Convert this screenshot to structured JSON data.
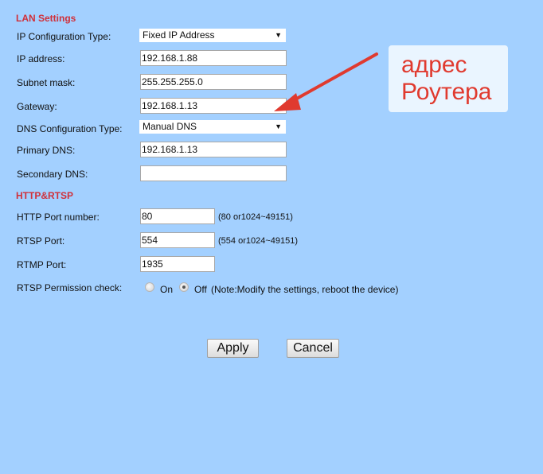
{
  "lan": {
    "title": "LAN Settings",
    "ip_config_label": "IP Configuration Type:",
    "ip_config_value": "Fixed IP Address",
    "ip_address_label": "IP address:",
    "ip_address_value": "192.168.1.88",
    "subnet_label": "Subnet mask:",
    "subnet_value": "255.255.255.0",
    "gateway_label": "Gateway:",
    "gateway_value": "192.168.1.13",
    "dns_config_label": "DNS Configuration Type:",
    "dns_config_value": "Manual DNS",
    "primary_dns_label": "Primary DNS:",
    "primary_dns_value": "192.168.1.13",
    "secondary_dns_label": "Secondary DNS:",
    "secondary_dns_value": ""
  },
  "http": {
    "title": "HTTP&RTSP",
    "http_port_label": "HTTP Port number:",
    "http_port_value": "80",
    "http_port_hint": "(80 or1024~49151)",
    "rtsp_port_label": "RTSP Port:",
    "rtsp_port_value": "554",
    "rtsp_port_hint": "(554 or1024~49151)",
    "rtmp_port_label": "RTMP Port:",
    "rtmp_port_value": "1935",
    "rtsp_perm_label": "RTSP Permission check:",
    "on_label": "On",
    "off_label": "Off",
    "selected": "Off",
    "note": "(Note:Modify the settings, reboot the device)"
  },
  "buttons": {
    "apply": "Apply",
    "cancel": "Cancel"
  },
  "annotation": {
    "line1": "адрес",
    "line2": "Роутера",
    "color": "#e03a2f"
  }
}
